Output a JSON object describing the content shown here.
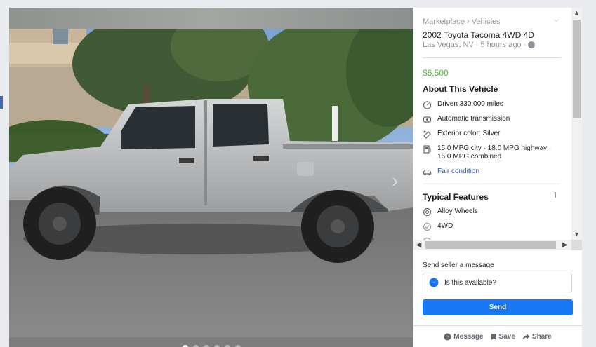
{
  "listing": {
    "breadcrumb": "Marketplace › Vehicles",
    "title": "2002 Toyota Tacoma 4WD 4D",
    "location": "Las Vegas, NV",
    "time_ago": "5 hours ago",
    "price": "$6,500"
  },
  "about": {
    "heading": "About This Vehicle",
    "items": [
      {
        "icon": "odometer-icon",
        "text": "Driven 330,000 miles"
      },
      {
        "icon": "transmission-icon",
        "text": "Automatic transmission"
      },
      {
        "icon": "paint-icon",
        "text": "Exterior color: Silver"
      },
      {
        "icon": "fuel-pump-icon",
        "text": "15.0 MPG city · 18.0 MPG highway · 16.0 MPG combined"
      },
      {
        "icon": "car-icon",
        "text": "Fair condition"
      }
    ]
  },
  "features": {
    "heading": "Typical Features",
    "items": [
      {
        "icon": "wheel-icon",
        "text": "Alloy Wheels"
      },
      {
        "icon": "check-circle-icon",
        "text": "4WD"
      }
    ]
  },
  "message": {
    "label": "Send seller a message",
    "input_value": "Is this available?",
    "send_label": "Send"
  },
  "actions": {
    "message": "Message",
    "save": "Save",
    "share": "Share"
  },
  "colors": {
    "accent": "#1877f2",
    "price": "#42b72a",
    "link": "#385898"
  }
}
